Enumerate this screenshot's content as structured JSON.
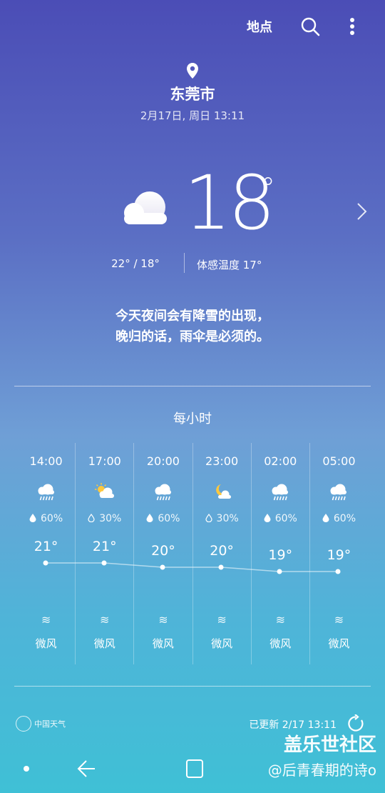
{
  "header": {
    "location_label": "地点",
    "search_icon": "search-icon",
    "more_icon": "more-vert-icon"
  },
  "location": {
    "city": "东莞市",
    "datetime": "2月17日, 周日 13:11"
  },
  "current": {
    "temp": "18",
    "deg": "°",
    "hi_lo": "22°  /  18°",
    "feels_like": "体感温度 17°",
    "message_line1": "今天夜间会有降雪的出现，",
    "message_line2": "晚归的话，雨伞是必须的。"
  },
  "hourly": {
    "title": "每小时",
    "items": [
      {
        "time": "14:00",
        "icon": "rain-icon",
        "precip": "60%",
        "temp": "21°",
        "temp_value": 21,
        "wind": "微风"
      },
      {
        "time": "17:00",
        "icon": "partly-cloudy-day-icon",
        "precip": "30%",
        "temp": "21°",
        "temp_value": 21,
        "wind": "微风"
      },
      {
        "time": "20:00",
        "icon": "rain-icon",
        "precip": "60%",
        "temp": "20°",
        "temp_value": 20,
        "wind": "微风"
      },
      {
        "time": "23:00",
        "icon": "partly-cloudy-night-icon",
        "precip": "30%",
        "temp": "20°",
        "temp_value": 20,
        "wind": "微风"
      },
      {
        "time": "02:00",
        "icon": "rain-icon",
        "precip": "60%",
        "temp": "19°",
        "temp_value": 19,
        "wind": "微风"
      },
      {
        "time": "05:00",
        "icon": "rain-icon",
        "precip": "60%",
        "temp": "19°",
        "temp_value": 19,
        "wind": "微风"
      }
    ],
    "wind_symbol": "≋",
    "drop_symbol": "💧"
  },
  "footer": {
    "brand": "中国天气",
    "updated": "已更新  2/17  13:11"
  },
  "watermark": {
    "line1": "盖乐世社区",
    "line2": "@后青春期的诗o"
  }
}
